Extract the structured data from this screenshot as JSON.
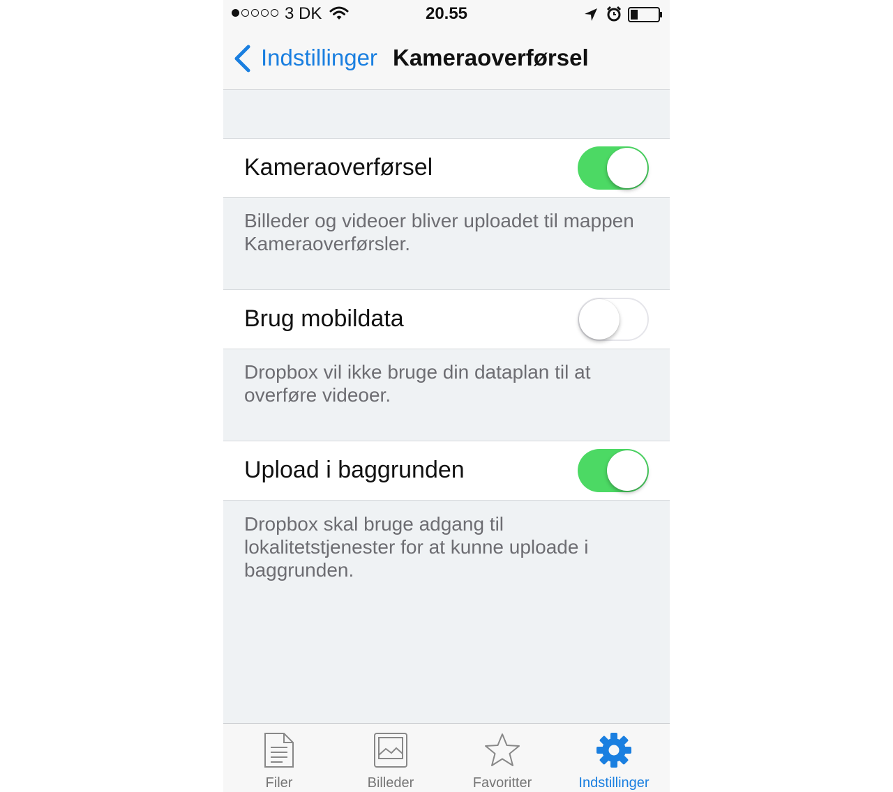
{
  "status_bar": {
    "carrier": "3 DK",
    "time": "20.55",
    "signal_bars_filled": 1,
    "signal_bars_total": 5
  },
  "nav": {
    "back_label": "Indstillinger",
    "title": "Kameraoverførsel"
  },
  "settings": [
    {
      "label": "Kameraoverførsel",
      "enabled": true,
      "footer": "Billeder og videoer bliver uploadet til mappen Kameraoverførsler."
    },
    {
      "label": "Brug mobildata",
      "enabled": false,
      "footer": "Dropbox vil ikke bruge din dataplan til at overføre videoer."
    },
    {
      "label": "Upload i baggrunden",
      "enabled": true,
      "footer": "Dropbox skal bruge adgang til lokalitetstjenester for at kunne uploade i baggrunden."
    }
  ],
  "tabs": [
    {
      "label": "Filer",
      "icon": "document-icon",
      "active": false
    },
    {
      "label": "Billeder",
      "icon": "photo-icon",
      "active": false
    },
    {
      "label": "Favoritter",
      "icon": "star-icon",
      "active": false
    },
    {
      "label": "Indstillinger",
      "icon": "gear-icon",
      "active": true
    }
  ],
  "colors": {
    "accent": "#1a7fe0",
    "toggle_on": "#4cd964",
    "background": "#eff2f4"
  }
}
